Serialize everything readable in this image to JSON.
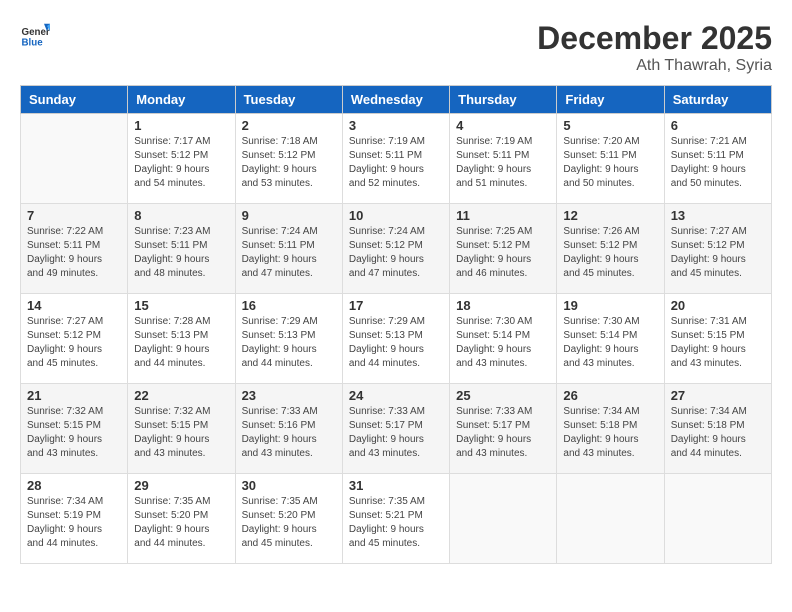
{
  "header": {
    "logo_general": "General",
    "logo_blue": "Blue",
    "month": "December 2025",
    "location": "Ath Thawrah, Syria"
  },
  "days_of_week": [
    "Sunday",
    "Monday",
    "Tuesday",
    "Wednesday",
    "Thursday",
    "Friday",
    "Saturday"
  ],
  "weeks": [
    [
      {
        "num": "",
        "sunrise": "",
        "sunset": "",
        "daylight": "",
        "empty": true
      },
      {
        "num": "1",
        "sunrise": "Sunrise: 7:17 AM",
        "sunset": "Sunset: 5:12 PM",
        "daylight": "Daylight: 9 hours and 54 minutes."
      },
      {
        "num": "2",
        "sunrise": "Sunrise: 7:18 AM",
        "sunset": "Sunset: 5:12 PM",
        "daylight": "Daylight: 9 hours and 53 minutes."
      },
      {
        "num": "3",
        "sunrise": "Sunrise: 7:19 AM",
        "sunset": "Sunset: 5:11 PM",
        "daylight": "Daylight: 9 hours and 52 minutes."
      },
      {
        "num": "4",
        "sunrise": "Sunrise: 7:19 AM",
        "sunset": "Sunset: 5:11 PM",
        "daylight": "Daylight: 9 hours and 51 minutes."
      },
      {
        "num": "5",
        "sunrise": "Sunrise: 7:20 AM",
        "sunset": "Sunset: 5:11 PM",
        "daylight": "Daylight: 9 hours and 50 minutes."
      },
      {
        "num": "6",
        "sunrise": "Sunrise: 7:21 AM",
        "sunset": "Sunset: 5:11 PM",
        "daylight": "Daylight: 9 hours and 50 minutes."
      }
    ],
    [
      {
        "num": "7",
        "sunrise": "Sunrise: 7:22 AM",
        "sunset": "Sunset: 5:11 PM",
        "daylight": "Daylight: 9 hours and 49 minutes."
      },
      {
        "num": "8",
        "sunrise": "Sunrise: 7:23 AM",
        "sunset": "Sunset: 5:11 PM",
        "daylight": "Daylight: 9 hours and 48 minutes."
      },
      {
        "num": "9",
        "sunrise": "Sunrise: 7:24 AM",
        "sunset": "Sunset: 5:11 PM",
        "daylight": "Daylight: 9 hours and 47 minutes."
      },
      {
        "num": "10",
        "sunrise": "Sunrise: 7:24 AM",
        "sunset": "Sunset: 5:12 PM",
        "daylight": "Daylight: 9 hours and 47 minutes."
      },
      {
        "num": "11",
        "sunrise": "Sunrise: 7:25 AM",
        "sunset": "Sunset: 5:12 PM",
        "daylight": "Daylight: 9 hours and 46 minutes."
      },
      {
        "num": "12",
        "sunrise": "Sunrise: 7:26 AM",
        "sunset": "Sunset: 5:12 PM",
        "daylight": "Daylight: 9 hours and 45 minutes."
      },
      {
        "num": "13",
        "sunrise": "Sunrise: 7:27 AM",
        "sunset": "Sunset: 5:12 PM",
        "daylight": "Daylight: 9 hours and 45 minutes."
      }
    ],
    [
      {
        "num": "14",
        "sunrise": "Sunrise: 7:27 AM",
        "sunset": "Sunset: 5:12 PM",
        "daylight": "Daylight: 9 hours and 45 minutes."
      },
      {
        "num": "15",
        "sunrise": "Sunrise: 7:28 AM",
        "sunset": "Sunset: 5:13 PM",
        "daylight": "Daylight: 9 hours and 44 minutes."
      },
      {
        "num": "16",
        "sunrise": "Sunrise: 7:29 AM",
        "sunset": "Sunset: 5:13 PM",
        "daylight": "Daylight: 9 hours and 44 minutes."
      },
      {
        "num": "17",
        "sunrise": "Sunrise: 7:29 AM",
        "sunset": "Sunset: 5:13 PM",
        "daylight": "Daylight: 9 hours and 44 minutes."
      },
      {
        "num": "18",
        "sunrise": "Sunrise: 7:30 AM",
        "sunset": "Sunset: 5:14 PM",
        "daylight": "Daylight: 9 hours and 43 minutes."
      },
      {
        "num": "19",
        "sunrise": "Sunrise: 7:30 AM",
        "sunset": "Sunset: 5:14 PM",
        "daylight": "Daylight: 9 hours and 43 minutes."
      },
      {
        "num": "20",
        "sunrise": "Sunrise: 7:31 AM",
        "sunset": "Sunset: 5:15 PM",
        "daylight": "Daylight: 9 hours and 43 minutes."
      }
    ],
    [
      {
        "num": "21",
        "sunrise": "Sunrise: 7:32 AM",
        "sunset": "Sunset: 5:15 PM",
        "daylight": "Daylight: 9 hours and 43 minutes."
      },
      {
        "num": "22",
        "sunrise": "Sunrise: 7:32 AM",
        "sunset": "Sunset: 5:15 PM",
        "daylight": "Daylight: 9 hours and 43 minutes."
      },
      {
        "num": "23",
        "sunrise": "Sunrise: 7:33 AM",
        "sunset": "Sunset: 5:16 PM",
        "daylight": "Daylight: 9 hours and 43 minutes."
      },
      {
        "num": "24",
        "sunrise": "Sunrise: 7:33 AM",
        "sunset": "Sunset: 5:17 PM",
        "daylight": "Daylight: 9 hours and 43 minutes."
      },
      {
        "num": "25",
        "sunrise": "Sunrise: 7:33 AM",
        "sunset": "Sunset: 5:17 PM",
        "daylight": "Daylight: 9 hours and 43 minutes."
      },
      {
        "num": "26",
        "sunrise": "Sunrise: 7:34 AM",
        "sunset": "Sunset: 5:18 PM",
        "daylight": "Daylight: 9 hours and 43 minutes."
      },
      {
        "num": "27",
        "sunrise": "Sunrise: 7:34 AM",
        "sunset": "Sunset: 5:18 PM",
        "daylight": "Daylight: 9 hours and 44 minutes."
      }
    ],
    [
      {
        "num": "28",
        "sunrise": "Sunrise: 7:34 AM",
        "sunset": "Sunset: 5:19 PM",
        "daylight": "Daylight: 9 hours and 44 minutes."
      },
      {
        "num": "29",
        "sunrise": "Sunrise: 7:35 AM",
        "sunset": "Sunset: 5:20 PM",
        "daylight": "Daylight: 9 hours and 44 minutes."
      },
      {
        "num": "30",
        "sunrise": "Sunrise: 7:35 AM",
        "sunset": "Sunset: 5:20 PM",
        "daylight": "Daylight: 9 hours and 45 minutes."
      },
      {
        "num": "31",
        "sunrise": "Sunrise: 7:35 AM",
        "sunset": "Sunset: 5:21 PM",
        "daylight": "Daylight: 9 hours and 45 minutes."
      },
      {
        "num": "",
        "sunrise": "",
        "sunset": "",
        "daylight": "",
        "empty": true
      },
      {
        "num": "",
        "sunrise": "",
        "sunset": "",
        "daylight": "",
        "empty": true
      },
      {
        "num": "",
        "sunrise": "",
        "sunset": "",
        "daylight": "",
        "empty": true
      }
    ]
  ]
}
